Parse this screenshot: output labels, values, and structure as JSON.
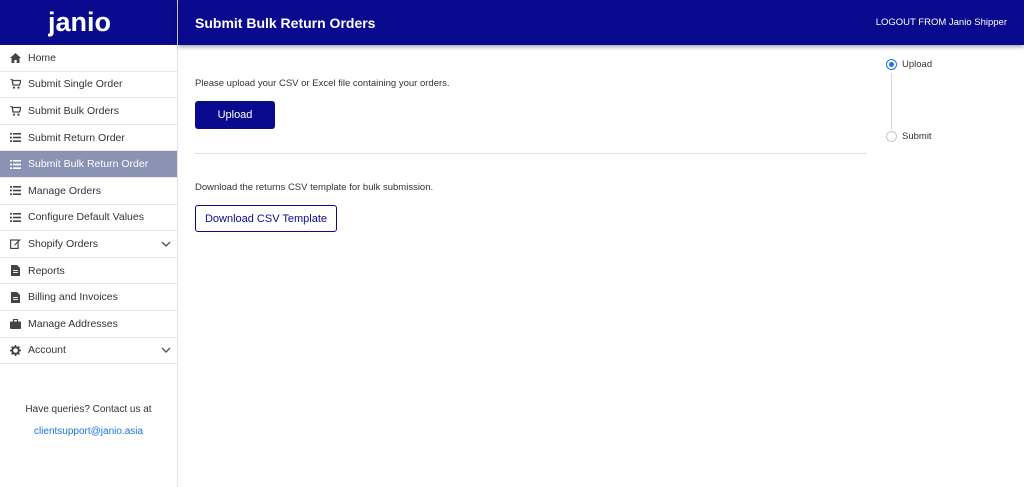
{
  "brand": {
    "logo_text": "janio",
    "primary_color": "#0a0a8e",
    "active_nav_color": "#8a93b3",
    "link_color": "#1a73e8"
  },
  "header": {
    "title": "Submit Bulk Return Orders",
    "logout_label": "LOGOUT FROM Janio Shipper"
  },
  "sidebar": {
    "items": [
      {
        "label": "Home",
        "icon": "home-icon",
        "active": false
      },
      {
        "label": "Submit Single Order",
        "icon": "cart-icon",
        "active": false
      },
      {
        "label": "Submit Bulk Orders",
        "icon": "cart-icon",
        "active": false
      },
      {
        "label": "Submit Return Order",
        "icon": "list-icon",
        "active": false
      },
      {
        "label": "Submit Bulk Return Order",
        "icon": "list-icon",
        "active": true
      },
      {
        "label": "Manage Orders",
        "icon": "list-icon",
        "active": false
      },
      {
        "label": "Configure Default Values",
        "icon": "list-icon",
        "active": false
      },
      {
        "label": "Shopify Orders",
        "icon": "edit-icon",
        "active": false,
        "expandable": true
      },
      {
        "label": "Reports",
        "icon": "file-icon",
        "active": false
      },
      {
        "label": "Billing and Invoices",
        "icon": "file-icon",
        "active": false
      },
      {
        "label": "Manage Addresses",
        "icon": "briefcase-icon",
        "active": false
      },
      {
        "label": "Account",
        "icon": "gear-icon",
        "active": false,
        "expandable": true
      }
    ],
    "help_text": "Have queries? Contact us at",
    "help_email": "clientsupport@janio.asia"
  },
  "main": {
    "upload_instruction": "Please upload your CSV or Excel file containing your orders.",
    "upload_button": "Upload",
    "template_instruction": "Download the returns CSV template for bulk submission.",
    "template_button": "Download CSV Template"
  },
  "stepper": {
    "steps": [
      {
        "label": "Upload",
        "active": true
      },
      {
        "label": "Submit",
        "active": false
      }
    ]
  }
}
